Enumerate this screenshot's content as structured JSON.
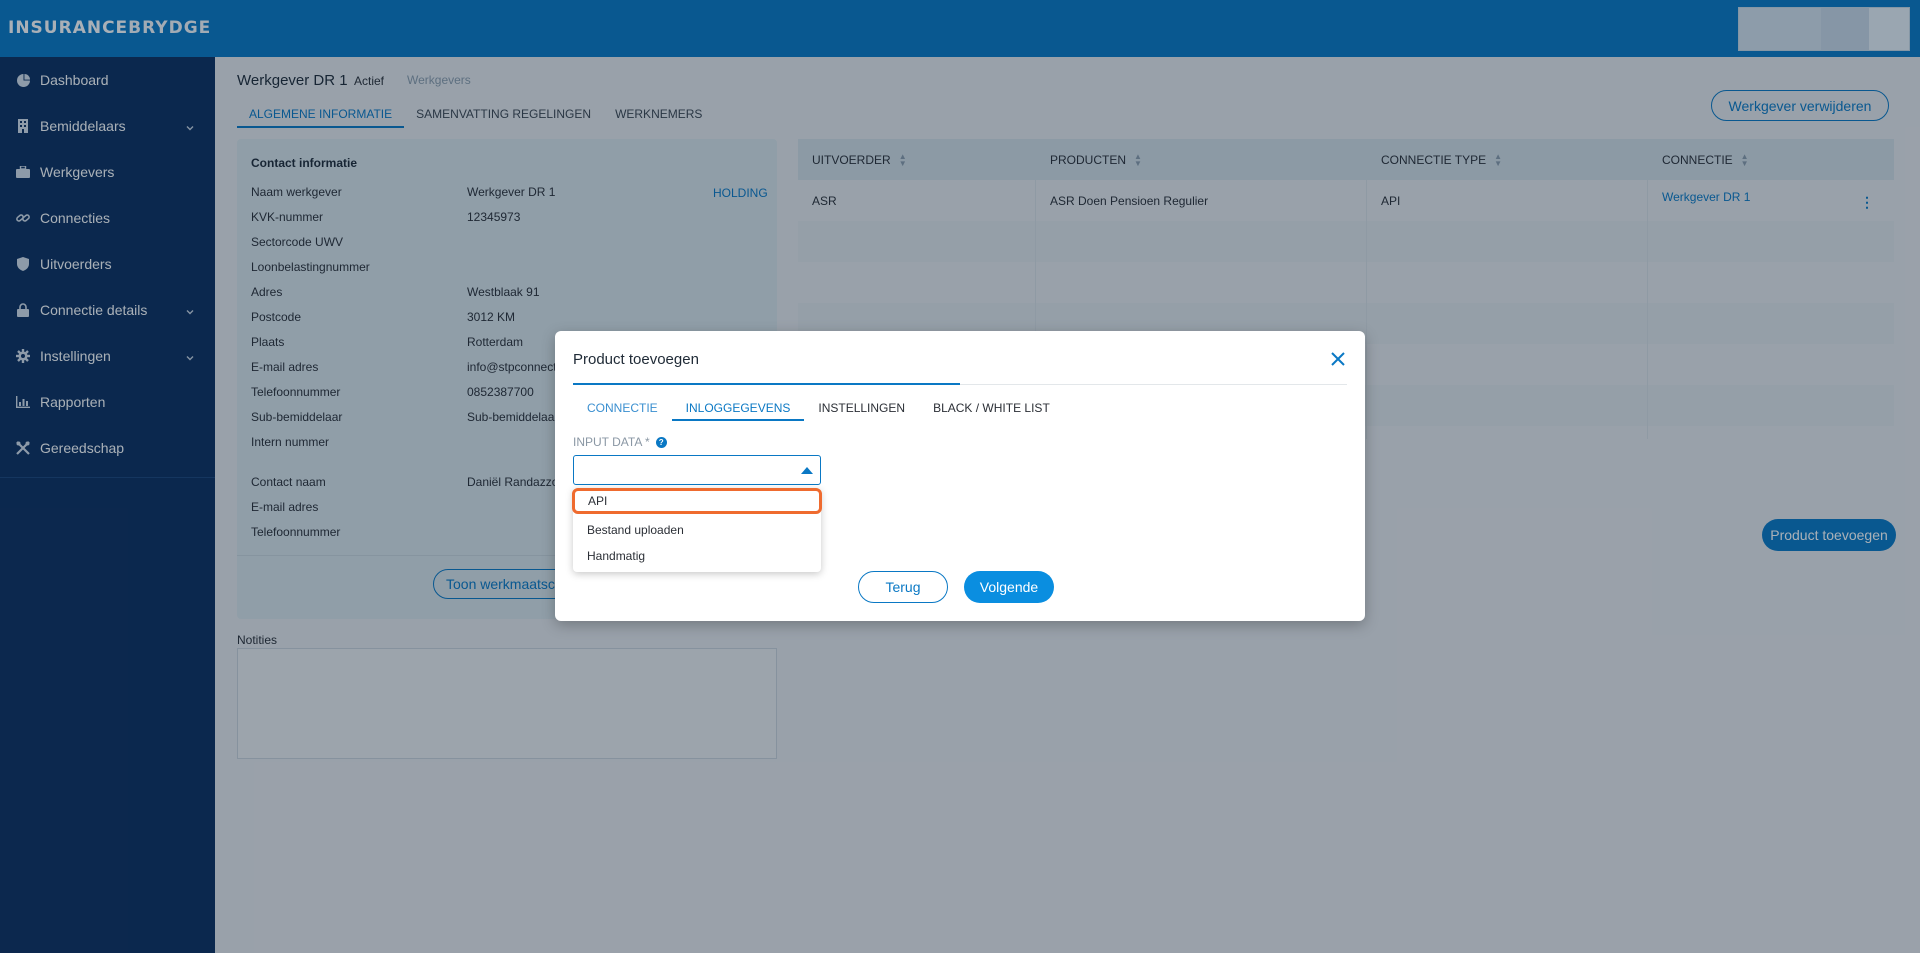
{
  "brand": {
    "part1": "INSURANCE",
    "part2": "BRYDGE"
  },
  "sidebar": {
    "items": [
      {
        "label": "Dashboard",
        "icon": "chart-pie-icon",
        "has_submenu": false
      },
      {
        "label": "Bemiddelaars",
        "icon": "building-icon",
        "has_submenu": true
      },
      {
        "label": "Werkgevers",
        "icon": "briefcase-icon",
        "has_submenu": false
      },
      {
        "label": "Connecties",
        "icon": "link-icon",
        "has_submenu": false
      },
      {
        "label": "Uitvoerders",
        "icon": "shield-icon",
        "has_submenu": false
      },
      {
        "label": "Connectie details",
        "icon": "lock-icon",
        "has_submenu": true
      },
      {
        "label": "Instellingen",
        "icon": "gear-icon",
        "has_submenu": true
      },
      {
        "label": "Rapporten",
        "icon": "bar-chart-icon",
        "has_submenu": false
      },
      {
        "label": "Gereedschap",
        "icon": "tools-icon",
        "has_submenu": false
      }
    ]
  },
  "employer": {
    "name": "Werkgever DR 1",
    "status": "Actief",
    "breadcrumb": "Werkgevers",
    "tabs": [
      "ALGEMENE INFORMATIE",
      "SAMENVATTING REGELINGEN",
      "WERKNEMERS"
    ],
    "delete_label": "Werkgever verwijderen"
  },
  "contact": {
    "heading": "Contact informatie",
    "holding_label": "HOLDING",
    "rows": [
      {
        "key": "Naam werkgever",
        "value": "Werkgever DR 1"
      },
      {
        "key": "KVK-nummer",
        "value": "12345973"
      },
      {
        "key": "Sectorcode UWV",
        "value": ""
      },
      {
        "key": "Loonbelastingnummer",
        "value": ""
      },
      {
        "key": "Adres",
        "value": "Westblaak 91"
      },
      {
        "key": "Postcode",
        "value": "3012 KM"
      },
      {
        "key": "Plaats",
        "value": "Rotterdam"
      },
      {
        "key": "E-mail adres",
        "value": "info@stpconnect"
      },
      {
        "key": "Telefoonnummer",
        "value": "0852387700"
      },
      {
        "key": "Sub-bemiddelaar",
        "value": "Sub-bemiddelaa"
      },
      {
        "key": "Intern nummer",
        "value": ""
      },
      {
        "key": "Contact naam",
        "value": "Daniël Randazzo"
      },
      {
        "key": "E-mail adres",
        "value": ""
      },
      {
        "key": "Telefoonnummer",
        "value": ""
      }
    ],
    "show_button": "Toon werkmaatschappijen"
  },
  "notes": {
    "label": "Notities"
  },
  "products": {
    "headers": [
      "UITVOERDER",
      "PRODUCTEN",
      "CONNECTIE TYPE",
      "CONNECTIE"
    ],
    "rows": [
      {
        "uitvoerder": "ASR",
        "product": "ASR Doen Pensioen Regulier",
        "type": "API",
        "connectie": "Werkgever DR 1"
      }
    ],
    "add_label": "Product toevoegen"
  },
  "modal": {
    "title": "Product toevoegen",
    "tabs": [
      "CONNECTIE",
      "INLOGGEGEVENS",
      "INSTELLINGEN",
      "BLACK / WHITE LIST"
    ],
    "field_label": "INPUT DATA *",
    "select_value": "",
    "options": [
      "API",
      "Bestand uploaden",
      "Handmatig"
    ],
    "back_label": "Terug",
    "next_label": "Volgende"
  },
  "colors": {
    "primary": "#0a78c4",
    "sidebar": "#0d2f5e",
    "highlight": "#ef6b2f"
  }
}
